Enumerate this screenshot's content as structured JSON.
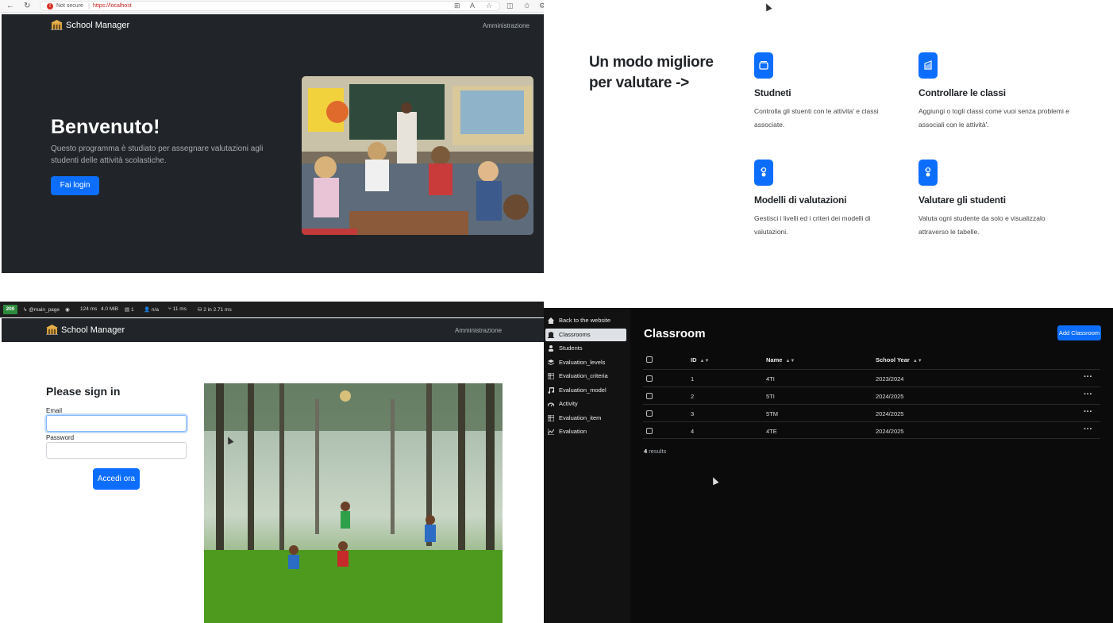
{
  "browser": {
    "security_label": "Not secure",
    "separator": "|",
    "url": "https://localhost"
  },
  "home": {
    "brand": "School Manager",
    "admin_link": "Amministrazione",
    "hero_title": "Benvenuto!",
    "hero_text": "Questo programma è studiato per assegnare valutazioni agli studenti delle attività scolastiche.",
    "login_button": "Fai login"
  },
  "features": {
    "heading": "Un modo migliore per valutare ->",
    "items": [
      {
        "title": "Studneti",
        "description": "Controlla gli stuenti con le attivita' e classi associate.",
        "icon": "collection-icon"
      },
      {
        "title": "Controllare le classi",
        "description": "Aggiungi o togli classi come vuoi senza problemi e associali con le attività'.",
        "icon": "building-icon"
      },
      {
        "title": "Modelli di valutazioni",
        "description": "Gestisci i livelli ed i criteri dei modelli di valutazioni.",
        "icon": "toggles-icon"
      },
      {
        "title": "Valutare gli studenti",
        "description": "Valuta ogni studente da solo e visualizzalo attraverso le tabelle.",
        "icon": "toggles-icon"
      }
    ]
  },
  "debugbar": {
    "status": "200",
    "route": "@main_page",
    "time": "124",
    "time_unit": "ms",
    "memory": "4.0",
    "memory_unit": "MiB",
    "forms": "1",
    "user": "n/a",
    "twig_time": "11",
    "twig_unit": "ms",
    "db_queries": "2",
    "db_in": "in",
    "db_time": "2.71",
    "db_unit": "ms"
  },
  "login": {
    "brand": "School Manager",
    "admin_link": "Amministrazione",
    "heading": "Please sign in",
    "email_label": "Email",
    "email_value": "",
    "password_label": "Password",
    "password_value": "",
    "submit": "Accedi ora"
  },
  "admin": {
    "sidebar": [
      {
        "label": "Back to the website",
        "icon": "home-icon"
      },
      {
        "label": "Classrooms",
        "icon": "school-icon",
        "active": true
      },
      {
        "label": "Students",
        "icon": "user-icon"
      },
      {
        "label": "Evaluation_levels",
        "icon": "layers-icon"
      },
      {
        "label": "Evaluation_criteria",
        "icon": "table-icon"
      },
      {
        "label": "Evaluation_model",
        "icon": "music-icon"
      },
      {
        "label": "Activity",
        "icon": "gauge-icon"
      },
      {
        "label": "Evaluation_item",
        "icon": "table-icon"
      },
      {
        "label": "Evaluation",
        "icon": "chart-icon"
      }
    ],
    "title": "Classroom",
    "add_button": "Add Classroom",
    "columns": [
      "ID",
      "Name",
      "School Year"
    ],
    "rows": [
      {
        "id": "1",
        "name": "4TI",
        "year": "2023/2024"
      },
      {
        "id": "2",
        "name": "5TI",
        "year": "2024/2025"
      },
      {
        "id": "3",
        "name": "5TM",
        "year": "2024/2025"
      },
      {
        "id": "4",
        "name": "4TE",
        "year": "2024/2025"
      }
    ],
    "results_count": "4",
    "results_label": "results",
    "row_actions": "···"
  },
  "colors": {
    "primary": "#0d6efd",
    "dark": "#212529",
    "admin_bg": "#0b0b0b"
  }
}
